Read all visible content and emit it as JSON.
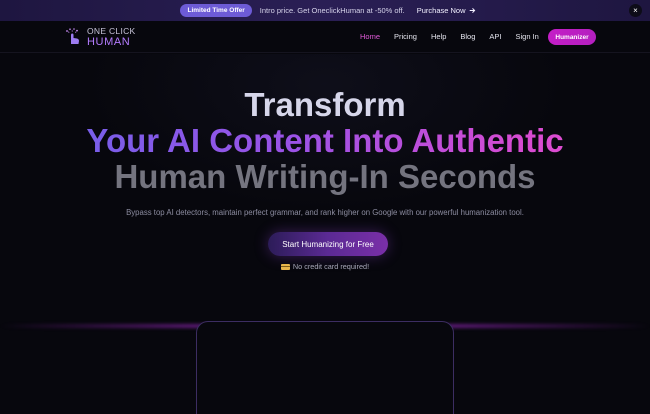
{
  "announcement": {
    "badge": "Limited Time Offer",
    "text": "Intro price. Get OneclickHuman at -50% off.",
    "link": "Purchase Now",
    "close": "×"
  },
  "brand": {
    "top": "ONE CLICK",
    "bottom": "HUMAN"
  },
  "nav": {
    "items": [
      {
        "label": "Home",
        "active": true
      },
      {
        "label": "Pricing"
      },
      {
        "label": "Help"
      },
      {
        "label": "Blog"
      },
      {
        "label": "API"
      },
      {
        "label": "Sign In"
      }
    ],
    "cta": "Humanizer"
  },
  "hero": {
    "line1": "Transform",
    "line2": "Your AI Content Into Authentic",
    "line3": "Human Writing-In Seconds",
    "subtitle": "Bypass top AI detectors, maintain perfect grammar, and rank higher on Google with our powerful humanization tool.",
    "cta": "Start Humanizing for Free",
    "note": "No credit card required!"
  },
  "colors": {
    "accent": "#c41ec7",
    "badge": "#6d5bd6",
    "active_nav": "#e05ad8",
    "gradient_start": "#6a63ea",
    "gradient_end": "#ea4fcf"
  }
}
